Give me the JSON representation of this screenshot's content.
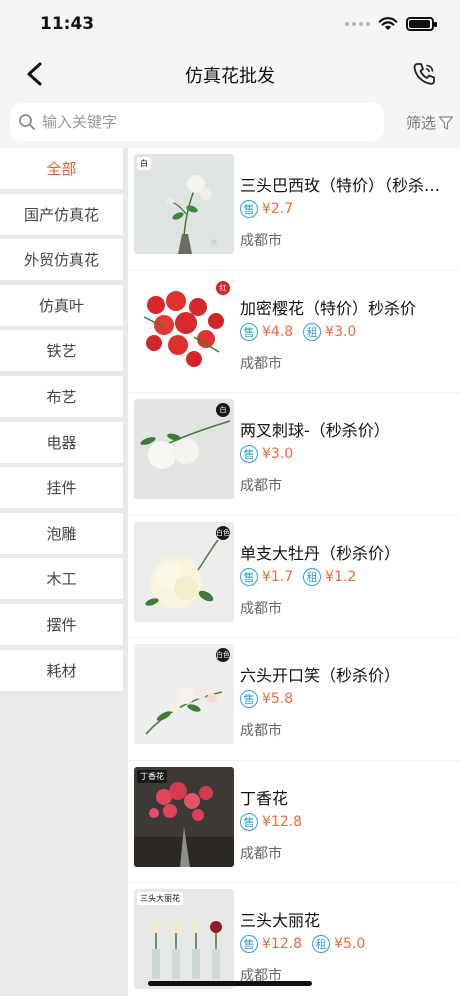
{
  "status_bar": {
    "time": "11:43"
  },
  "nav": {
    "title": "仿真花批发",
    "back_icon": "chevron-left-icon",
    "phone_icon": "phone-icon"
  },
  "search": {
    "placeholder": "输入关键字",
    "value": "",
    "filter_label": "筛选"
  },
  "colors": {
    "accent": "#ee5a2f",
    "price": "#ee6a36",
    "badge_blue": "#2f9fe0",
    "sidebar_bg": "#e9e9e9"
  },
  "sidebar": {
    "items": [
      {
        "label": "全部",
        "active": true
      },
      {
        "label": "国产仿真花",
        "active": false
      },
      {
        "label": "外贸仿真花",
        "active": false
      },
      {
        "label": "仿真叶",
        "active": false
      },
      {
        "label": "铁艺",
        "active": false
      },
      {
        "label": "布艺",
        "active": false
      },
      {
        "label": "电器",
        "active": false
      },
      {
        "label": "挂件",
        "active": false
      },
      {
        "label": "泡雕",
        "active": false
      },
      {
        "label": "木工",
        "active": false
      },
      {
        "label": "摆件",
        "active": false
      },
      {
        "label": "耗材",
        "active": false
      }
    ]
  },
  "products": [
    {
      "name": "三头巴西玫（特价）（秒杀价）",
      "sale_badge": "售",
      "sale_price": "¥2.7",
      "rent_badge": "",
      "rent_price": "",
      "city": "成都市",
      "thumb_tag": "白"
    },
    {
      "name": "加密樱花（特价）秒杀价",
      "sale_badge": "售",
      "sale_price": "¥4.8",
      "rent_badge": "租",
      "rent_price": "¥3.0",
      "city": "成都市",
      "thumb_tag": "红"
    },
    {
      "name": "两叉刺球-（秒杀价）",
      "sale_badge": "售",
      "sale_price": "¥3.0",
      "rent_badge": "",
      "rent_price": "",
      "city": "成都市",
      "thumb_tag": "白"
    },
    {
      "name": "单支大牡丹（秒杀价）",
      "sale_badge": "售",
      "sale_price": "¥1.7",
      "rent_badge": "租",
      "rent_price": "¥1.2",
      "city": "成都市",
      "thumb_tag": "白色"
    },
    {
      "name": "六头开口笑（秒杀价）",
      "sale_badge": "售",
      "sale_price": "¥5.8",
      "rent_badge": "",
      "rent_price": "",
      "city": "成都市",
      "thumb_tag": "白色"
    },
    {
      "name": "丁香花",
      "sale_badge": "售",
      "sale_price": "¥12.8",
      "rent_badge": "",
      "rent_price": "",
      "city": "成都市",
      "thumb_tag": "丁香花"
    },
    {
      "name": "三头大丽花",
      "sale_badge": "售",
      "sale_price": "¥12.8",
      "rent_badge": "租",
      "rent_price": "¥5.0",
      "city": "成都市",
      "thumb_tag": "三头大丽花"
    }
  ]
}
